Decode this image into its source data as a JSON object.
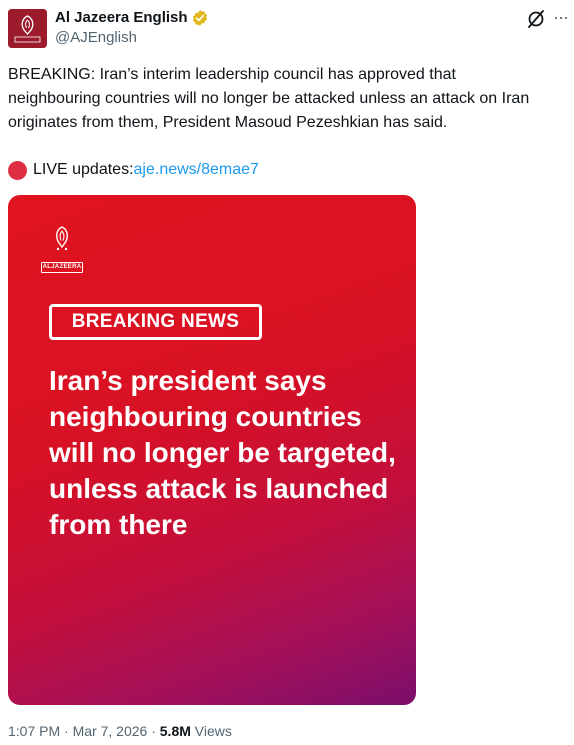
{
  "account": {
    "display_name": "Al Jazeera English",
    "handle": "@AJEnglish",
    "avatar_logo_text": "ALJAZEERA",
    "verified_icon": "gold-verified-badge",
    "grok_icon": "grok-slash-icon",
    "more_icon": "more-horizontal-icon"
  },
  "tweet": {
    "text": "BREAKING: Iran’s interim leadership council has approved that neighbouring countries will no longer be attacked unless an attack on Iran originates from them, President Masoud Pezeshkian has said.",
    "live_prefix": "LIVE updates: ",
    "live_link": "aje.news/8emae7",
    "live_icon": "red-circle-emoji"
  },
  "card": {
    "logo_text": "ALJAZEERA",
    "badge": "BREAKING NEWS",
    "headline": "Iran’s president says neighbouring countries will no longer be targeted, unless attack is launched from there",
    "gradient_start": "#e0141f",
    "gradient_end": "#7b0e6b"
  },
  "meta": {
    "time": "1:07 PM",
    "separator": " · ",
    "date": "Mar 7, 2026",
    "views_count": "5.8M",
    "views_label": " Views"
  },
  "colors": {
    "text": "#0f1419",
    "secondary": "#536471",
    "link": "#1d9bf0",
    "verified": "#e2b719"
  }
}
